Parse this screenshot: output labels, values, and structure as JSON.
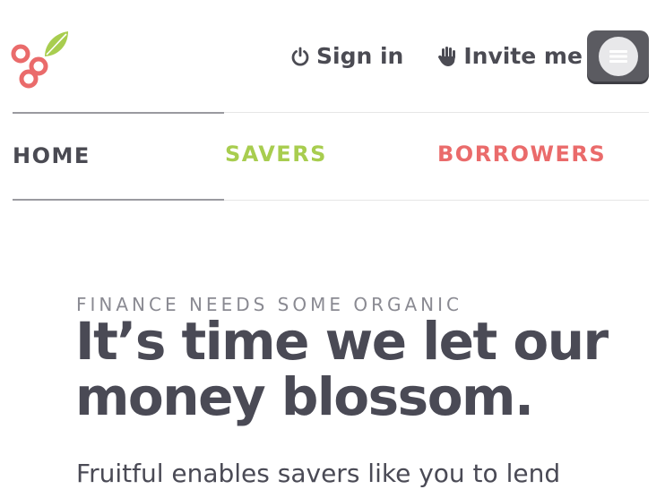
{
  "header": {
    "sign_in_label": "Sign in",
    "invite_label": "Invite me",
    "logo_colors": {
      "berry": "#ea6b6b",
      "leaf": "#a8cd4f"
    }
  },
  "nav": {
    "home_label": "HOME",
    "savers_label": "SAVERS",
    "borrowers_label": "BORROWERS",
    "active": "HOME"
  },
  "hero": {
    "eyebrow": "FINANCE NEEDS SOME ORGANIC",
    "headline_line1": "It’s time we let our",
    "headline_line2": "money blossom.",
    "intro": "Fruitful enables savers like you to lend"
  },
  "colors": {
    "text": "#4a4a55",
    "savers": "#a8cd4f",
    "borrowers": "#ea6b6b",
    "menu_button": "#5b5b61"
  }
}
